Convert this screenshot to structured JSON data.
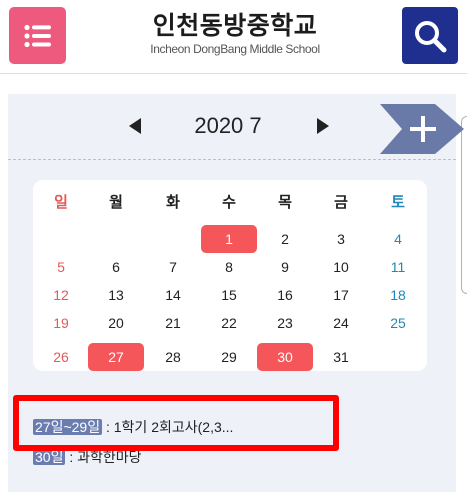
{
  "header": {
    "school_name": "인천동방중학교",
    "school_subtitle": "Incheon DongBang Middle School",
    "menu_icon": "list-icon",
    "search_icon": "search-icon",
    "colors": {
      "menu": "#ee5a7d",
      "search": "#1e2f8f"
    }
  },
  "calendar": {
    "month_label": "2020 7",
    "add_icon": "plus-icon",
    "weekdays": [
      "일",
      "월",
      "화",
      "수",
      "목",
      "금",
      "토"
    ],
    "weeks": [
      [
        "",
        "",
        "",
        "1",
        "2",
        "3",
        "4"
      ],
      [
        "5",
        "6",
        "7",
        "8",
        "9",
        "10",
        "11"
      ],
      [
        "12",
        "13",
        "14",
        "15",
        "16",
        "17",
        "18"
      ],
      [
        "19",
        "20",
        "21",
        "22",
        "23",
        "24",
        "25"
      ],
      [
        "26",
        "27",
        "28",
        "29",
        "30",
        "31",
        ""
      ]
    ],
    "highlighted_days": [
      "1",
      "27",
      "30"
    ],
    "colors": {
      "sunday": "#e25a5a",
      "saturday": "#1f88b9",
      "highlight": "#f4565a"
    }
  },
  "events": [
    {
      "date": "27일~29일",
      "text": " : 1학기 2회고사(2,3..."
    },
    {
      "date": "30일",
      "text": " : 과학한마당"
    }
  ]
}
